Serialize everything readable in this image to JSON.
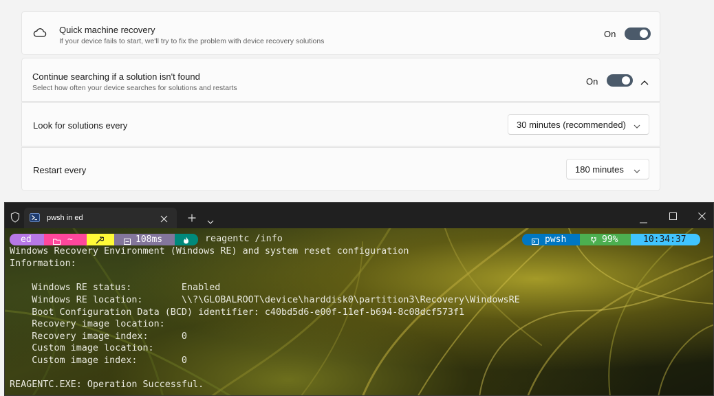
{
  "settings": {
    "quick_recovery": {
      "icon": "cloud-icon",
      "title": "Quick machine recovery",
      "description": "If your device fails to start, we'll try to fix the problem with device recovery solutions",
      "state_label": "On",
      "enabled": true
    },
    "continue_search": {
      "title": "Continue searching if a solution isn't found",
      "description": "Select how often your device searches for solutions and restarts",
      "state_label": "On",
      "enabled": true,
      "expanded": true
    },
    "look_for": {
      "label": "Look for solutions every",
      "selected": "30 minutes (recommended)"
    },
    "restart_every": {
      "label": "Restart every",
      "selected": "180 minutes"
    }
  },
  "terminal": {
    "tab_title": "pwsh in ed",
    "tab_icon": "powershell-icon",
    "prompt": {
      "user": "ed",
      "dir_icon": "folder-icon",
      "dir": "~",
      "git_icon": "wrench-icon",
      "exec_time": "108ms",
      "exec_icon": "timer-icon",
      "shell_icon": "flame-icon",
      "command": "reagentc /info",
      "shell": "pwsh",
      "battery": "99%",
      "time": "10:34:37",
      "colors": {
        "user": "#b778e6",
        "dir": "#ff479c",
        "git": "#fffb38",
        "exec": "#83769c",
        "shell_seg": "#00897b",
        "pwsh": "#0077c2",
        "battery": "#4caf50",
        "time": "#40c4ff"
      }
    },
    "output": [
      "Windows Recovery Environment (Windows RE) and system reset configuration",
      "Information:",
      "",
      "    Windows RE status:         Enabled",
      "    Windows RE location:       \\\\?\\GLOBALROOT\\device\\harddisk0\\partition3\\Recovery\\WindowsRE",
      "    Boot Configuration Data (BCD) identifier: c40bd5d6-e00f-11ef-b694-8c08dcf573f1",
      "    Recovery image location:",
      "    Recovery image index:      0",
      "    Custom image location:",
      "    Custom image index:        0",
      "",
      "REAGENTC.EXE: Operation Successful."
    ]
  }
}
